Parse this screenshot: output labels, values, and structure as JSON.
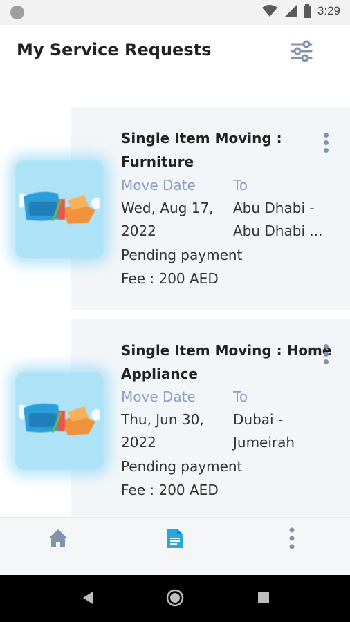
{
  "status_bar": {
    "time": "3:29"
  },
  "header": {
    "title": "My Service Requests",
    "filter_icon": "sliders-icon"
  },
  "requests": [
    {
      "title": "Single Item Moving : Furniture",
      "move_date_label": "Move Date",
      "to_label": "To",
      "move_date": "Wed, Aug 17, 2022",
      "to": "Abu Dhabi - Abu Dhabi ...",
      "status": "Pending payment",
      "fee": "Fee : 200 AED"
    },
    {
      "title": "Single Item Moving : Home Appliance",
      "move_date_label": "Move Date",
      "to_label": "To",
      "move_date": "Thu, Jun 30, 2022",
      "to": "Dubai - Jumeirah",
      "status": "Pending payment",
      "fee": "Fee : 200 AED"
    }
  ],
  "bottom_nav": {
    "items": [
      "home-icon",
      "document-icon",
      "more-vertical-icon"
    ],
    "active": "document-icon"
  },
  "colors": {
    "accent": "#29a8e0",
    "label": "#8e9fc6",
    "card_bg": "#f3f6f8",
    "icon": "#8292ad"
  }
}
